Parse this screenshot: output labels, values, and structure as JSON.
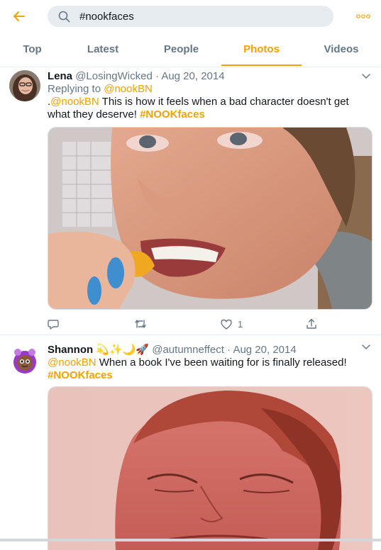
{
  "colors": {
    "accent": "#f5a100",
    "muted": "#657786",
    "text": "#14171a"
  },
  "header": {
    "back_icon": "arrow-left-icon",
    "search_value": "#nookfaces",
    "more_icon": "more-dots-icon"
  },
  "tabs": [
    {
      "label": "Top"
    },
    {
      "label": "Latest"
    },
    {
      "label": "People"
    },
    {
      "label": "Photos",
      "active": true
    },
    {
      "label": "Videos"
    }
  ],
  "tweets": [
    {
      "name": "Lena",
      "handle": "@LosingWicked",
      "separator": "·",
      "date": "Aug 20, 2014",
      "replying_label": "Replying to",
      "replying_handle": "@nookBN",
      "text_prefix": ".",
      "mention": "@nookBN",
      "text_body": " This is how it feels when a bad character doesn't get what they deserve! ",
      "hashtag": "#NOOKfaces",
      "reply_count": "",
      "retweet_count": "",
      "like_count": "1"
    },
    {
      "name": "Shannon",
      "name_emojis": "💫✨🌙🚀",
      "handle": "@autumneffect",
      "separator": "·",
      "date": "Aug 20, 2014",
      "mention": "@nookBN",
      "text_body": " When a book I've been waiting for is finally released!",
      "hashtag": "#NOOKfaces"
    }
  ]
}
